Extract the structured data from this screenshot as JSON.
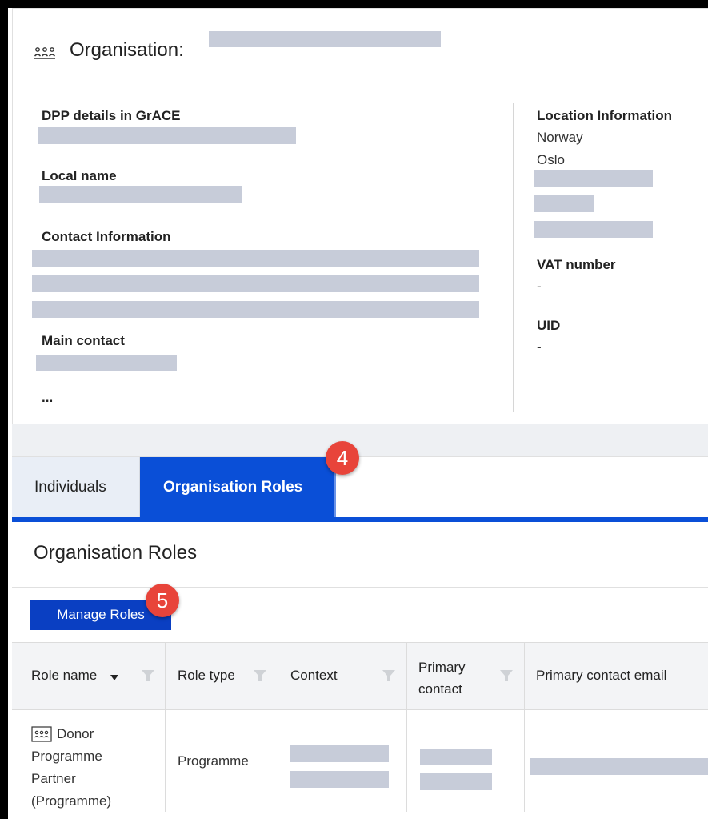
{
  "organisation": {
    "title": "Organisation:",
    "icon": "people-group-icon"
  },
  "details": {
    "dpp_label": "DPP details in GrACE",
    "local_name_label": "Local name",
    "contact_label": "Contact Information",
    "main_contact_label": "Main contact",
    "more": "...",
    "location_label": "Location Information",
    "country": "Norway",
    "city": "Oslo",
    "vat_label": "VAT number",
    "vat_value": "-",
    "uid_label": "UID",
    "uid_value": "-"
  },
  "tabs": [
    {
      "label": "Individuals",
      "active": false
    },
    {
      "label": "Organisation Roles",
      "active": true
    }
  ],
  "badges": {
    "tab": "4",
    "button": "5"
  },
  "roles": {
    "title": "Organisation Roles",
    "manage_button": "Manage Roles",
    "columns": [
      "Role name",
      "Role type",
      "Context",
      "Primary contact",
      "Primary contact email"
    ],
    "rows": [
      {
        "role_name": "Donor Programme Partner (Programme)",
        "role_type": "Programme"
      }
    ]
  },
  "colors": {
    "accent": "#0a4fd7",
    "badge": "#e8443a"
  }
}
